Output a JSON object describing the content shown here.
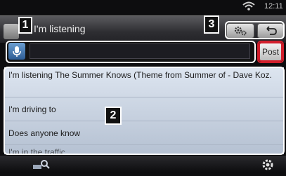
{
  "status": {
    "time": "12:11"
  },
  "title": "I'm listening",
  "input": {
    "value": "",
    "placeholder": ""
  },
  "post_label": "Post",
  "list": [
    "I'm listening The Summer Knows (Theme from Summer of  - Dave Koz.",
    "I'm driving to",
    "Does anyone know",
    "I'm in the traffic"
  ],
  "callouts": {
    "one": "1",
    "two": "2",
    "three": "3"
  },
  "colors": {
    "accent_red": "#d21f2c",
    "mic_blue": "#3d73ad",
    "list_bg": "#cdd6e3"
  }
}
